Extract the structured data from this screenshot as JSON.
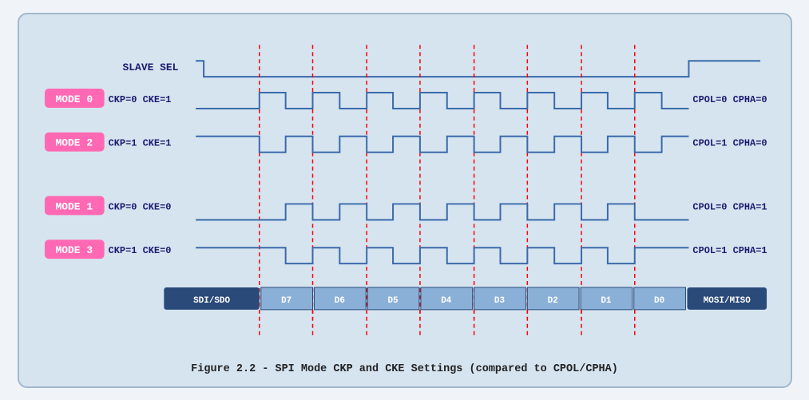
{
  "caption": "Figure 2.2 - SPI Mode CKP and CKE Settings (compared to CPOL/CPHA)",
  "modes": [
    {
      "label": "MODE 0",
      "ckp": "CKP=0 CKE=1",
      "cpol": "CPOL=0 CPHA=0"
    },
    {
      "label": "MODE 2",
      "ckp": "CKP=1 CKE=1",
      "cpol": "CPOL=1 CPHA=0"
    },
    {
      "label": "MODE 1",
      "ckp": "CKP=0 CKE=0",
      "cpol": "CPOL=0 CPHA=1"
    },
    {
      "label": "MODE 3",
      "ckp": "CKP=1 CKE=0",
      "cpol": "CPOL=1 CPHA=1"
    }
  ],
  "data_labels": [
    "SDI/SDO",
    "D7",
    "D6",
    "D5",
    "D4",
    "D3",
    "D2",
    "D1",
    "D0",
    "MOSI/MISO"
  ],
  "slave_label": "SLAVE SEL"
}
